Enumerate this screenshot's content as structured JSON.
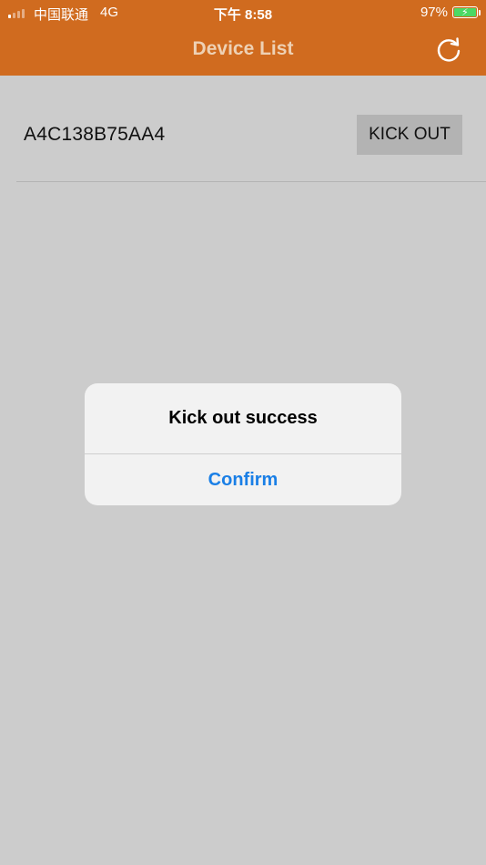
{
  "status_bar": {
    "carrier": "中国联通",
    "network": "4G",
    "time": "下午 8:58",
    "battery_percent": "97%"
  },
  "nav": {
    "title": "Device List",
    "refresh_icon": "refresh-icon"
  },
  "devices": [
    {
      "id": "A4C138B75AA4",
      "action_label": "KICK OUT"
    }
  ],
  "alert": {
    "message": "Kick out success",
    "confirm_label": "Confirm"
  },
  "colors": {
    "nav_background": "#d06b1f",
    "page_background": "#cccccc",
    "alert_button": "#1a7fe6"
  }
}
